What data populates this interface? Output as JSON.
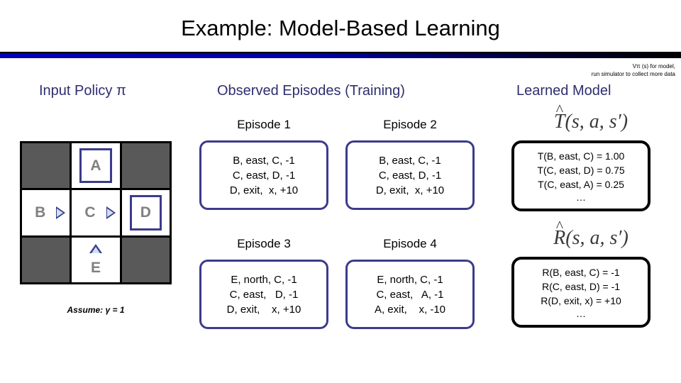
{
  "slide": {
    "title": "Example: Model-Based Learning",
    "top_note_line1": "Vπ (s) for model,",
    "top_note_line2": "run simulator to collect more data",
    "accent_navy": "#3b3b8c",
    "heading_color": "#2e2e6e",
    "wall_color": "#595959",
    "rule_color": "#0000bb"
  },
  "policy": {
    "heading": "Input Policy π",
    "assume": "Assume: γ = 1",
    "grid": [
      [
        {
          "label": "",
          "type": "wall",
          "arrow": "none"
        },
        {
          "label": "A",
          "type": "terminal",
          "arrow": "none"
        },
        {
          "label": "",
          "type": "wall",
          "arrow": "none"
        }
      ],
      [
        {
          "label": "B",
          "type": "normal",
          "arrow": "east"
        },
        {
          "label": "C",
          "type": "normal",
          "arrow": "east"
        },
        {
          "label": "D",
          "type": "terminal",
          "arrow": "none"
        }
      ],
      [
        {
          "label": "",
          "type": "wall",
          "arrow": "none"
        },
        {
          "label": "E",
          "type": "normal",
          "arrow": "north"
        },
        {
          "label": "",
          "type": "wall",
          "arrow": "none"
        }
      ]
    ]
  },
  "episodes": {
    "heading": "Observed Episodes (Training)",
    "items": [
      {
        "title": "Episode 1",
        "lines": [
          "B, east, C, -1",
          "C, east, D, -1",
          "D, exit,  x, +10"
        ]
      },
      {
        "title": "Episode 2",
        "lines": [
          "B, east, C, -1",
          "C, east, D, -1",
          "D, exit,  x, +10"
        ]
      },
      {
        "title": "Episode 3",
        "lines": [
          "E, north, C, -1",
          "C, east,   D, -1",
          "D, exit,    x, +10"
        ]
      },
      {
        "title": "Episode 4",
        "lines": [
          "E, north, C, -1",
          "C, east,   A, -1",
          "A, exit,    x, -10"
        ]
      }
    ]
  },
  "learned_model": {
    "heading": "Learned Model",
    "transition": {
      "math_symbol": "T",
      "math_args": "(s, a, s′)",
      "lines": [
        "T(B, east, C) = 1.00",
        "T(C, east, D) = 0.75",
        "T(C, east, A) = 0.25"
      ],
      "ellipsis": "…"
    },
    "reward": {
      "math_symbol": "R",
      "math_args": "(s, a, s′)",
      "lines": [
        "R(B, east, C) = -1",
        "R(C, east, D) = -1",
        "R(D, exit, x) = +10"
      ],
      "ellipsis": "…"
    }
  }
}
